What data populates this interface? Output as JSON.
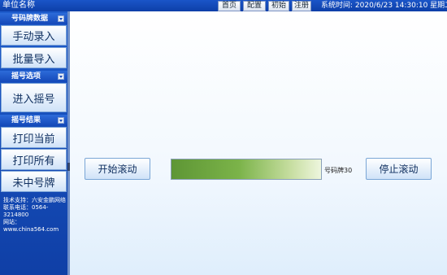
{
  "header": {
    "unit_name": "单位名称",
    "nav": [
      "首页",
      "配置",
      "初始",
      "注册"
    ],
    "system_time": "系统时间: 2020/6/23 14:30:10 星期二"
  },
  "sidebar": {
    "sections": [
      {
        "title": "号码牌数据",
        "buttons": [
          "手动录入",
          "批量导入"
        ]
      },
      {
        "title": "摇号选项",
        "buttons": [
          "进入摇号"
        ]
      },
      {
        "title": "摇号结果",
        "buttons": [
          "打印当前",
          "打印所有",
          "未中号牌"
        ]
      }
    ],
    "support": [
      "技术支持：六安金鹏网络",
      "联系电话：0564-3214800",
      "网站：www.china564.com"
    ]
  },
  "main": {
    "start_label": "开始滚动",
    "stop_label": "停止滚动",
    "number_label": "号码牌30"
  },
  "colors": {
    "topbar": "#0d3fa8",
    "sidebar": "#1448b8",
    "button_border": "#7aa6d6",
    "rolling_green": "#7bb349"
  }
}
